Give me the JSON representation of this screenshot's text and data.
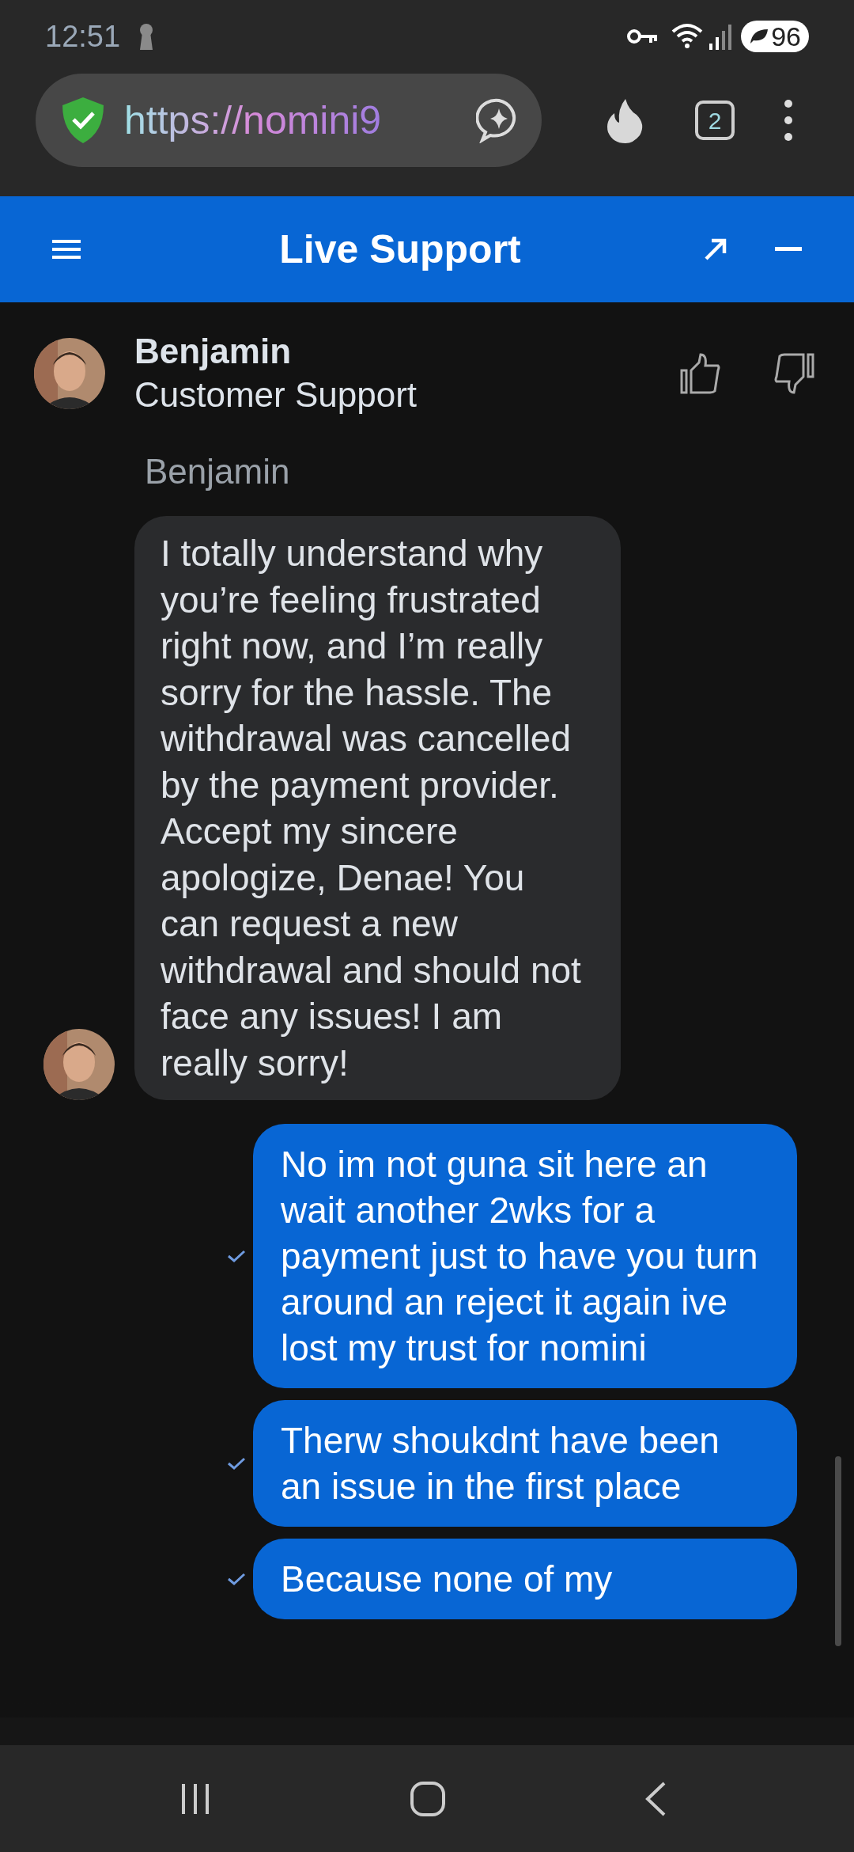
{
  "status_bar": {
    "time": "12:51",
    "battery": "96"
  },
  "browser": {
    "url": "https://nomini9",
    "tab_count": "2"
  },
  "header": {
    "title": "Live Support"
  },
  "agent": {
    "name": "Benjamin",
    "role": "Customer Support"
  },
  "messages": [
    {
      "kind": "agent",
      "sender": "Benjamin",
      "text": "I totally understand why you’re feeling frustrated right now, and I’m really sorry for the hassle. The withdrawal was cancelled by the payment provider. Accept my sincere apologize, Denae! You can request a new withdrawal and should not face any issues! I am really sorry!"
    },
    {
      "kind": "user",
      "delivered": true,
      "text": "No im not guna sit here an wait another 2wks for a payment just to have you turn around an reject it again ive lost my trust for nomini"
    },
    {
      "kind": "user",
      "delivered": true,
      "text": "Therw shoukdnt have been an issue in the first place"
    },
    {
      "kind": "user",
      "delivered": true,
      "text": "Because none of my"
    }
  ]
}
